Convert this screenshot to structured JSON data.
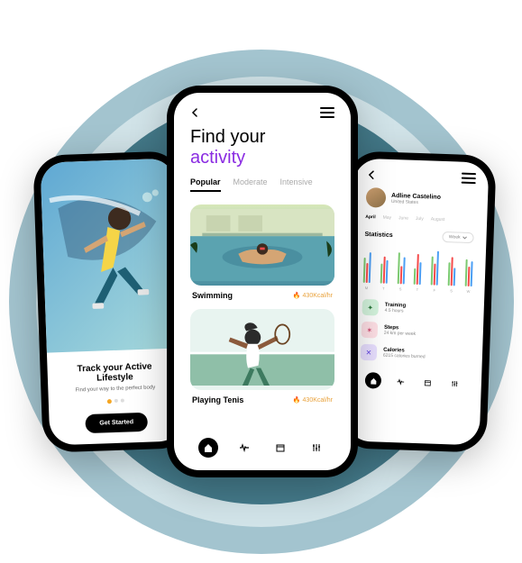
{
  "onboard": {
    "title": "Track your Active Lifestyle",
    "subtitle": "Find your way to the perfect body",
    "cta": "Get Started"
  },
  "activity": {
    "heading_line1": "Find your",
    "heading_line2": "activity",
    "tabs": [
      "Popular",
      "Moderate",
      "Intensive"
    ],
    "cards": [
      {
        "title": "Swimming",
        "meta": "430Kcal/hr"
      },
      {
        "title": "Playing Tenis",
        "meta": "430Kcal/hr"
      }
    ]
  },
  "stats": {
    "profile_name": "Adline Castelino",
    "profile_location": "United States",
    "months": [
      "April",
      "May",
      "June",
      "July",
      "August"
    ],
    "section_title": "Statistics",
    "period_selector": "Week",
    "metrics": [
      {
        "title": "Training",
        "value": "4.5 hours"
      },
      {
        "title": "Steps",
        "value": "24 km per week"
      },
      {
        "title": "Calories",
        "value": "6215 calories burned"
      }
    ]
  },
  "chart_data": {
    "type": "bar",
    "title": "Statistics",
    "xlabel": "",
    "ylabel": "",
    "categories": [
      "M",
      "T",
      "S",
      "T",
      "F",
      "S",
      "W"
    ],
    "series": [
      {
        "name": "Training",
        "color": "#7bc96f",
        "values": [
          28,
          22,
          35,
          18,
          32,
          26,
          30
        ]
      },
      {
        "name": "Steps",
        "color": "#f54b4b",
        "values": [
          22,
          30,
          20,
          34,
          24,
          32,
          22
        ]
      },
      {
        "name": "Calories",
        "color": "#4b9ff5",
        "values": [
          34,
          26,
          30,
          25,
          38,
          20,
          28
        ]
      }
    ],
    "ylim": [
      0,
      40
    ]
  }
}
